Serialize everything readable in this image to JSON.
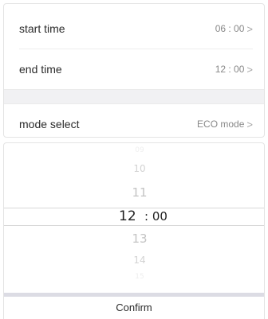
{
  "settings": {
    "rows": [
      {
        "label": "start time",
        "value": "06 : 00"
      },
      {
        "label": "end time",
        "value": "12 : 00"
      },
      {
        "label": "mode select",
        "value": "ECO mode"
      }
    ],
    "chevron": ">"
  },
  "picker": {
    "hours": [
      "09",
      "10",
      "11",
      "12",
      "13",
      "14",
      "15"
    ],
    "selected_hour": "12",
    "separator": ": 00",
    "confirm_label": "Confirm"
  }
}
